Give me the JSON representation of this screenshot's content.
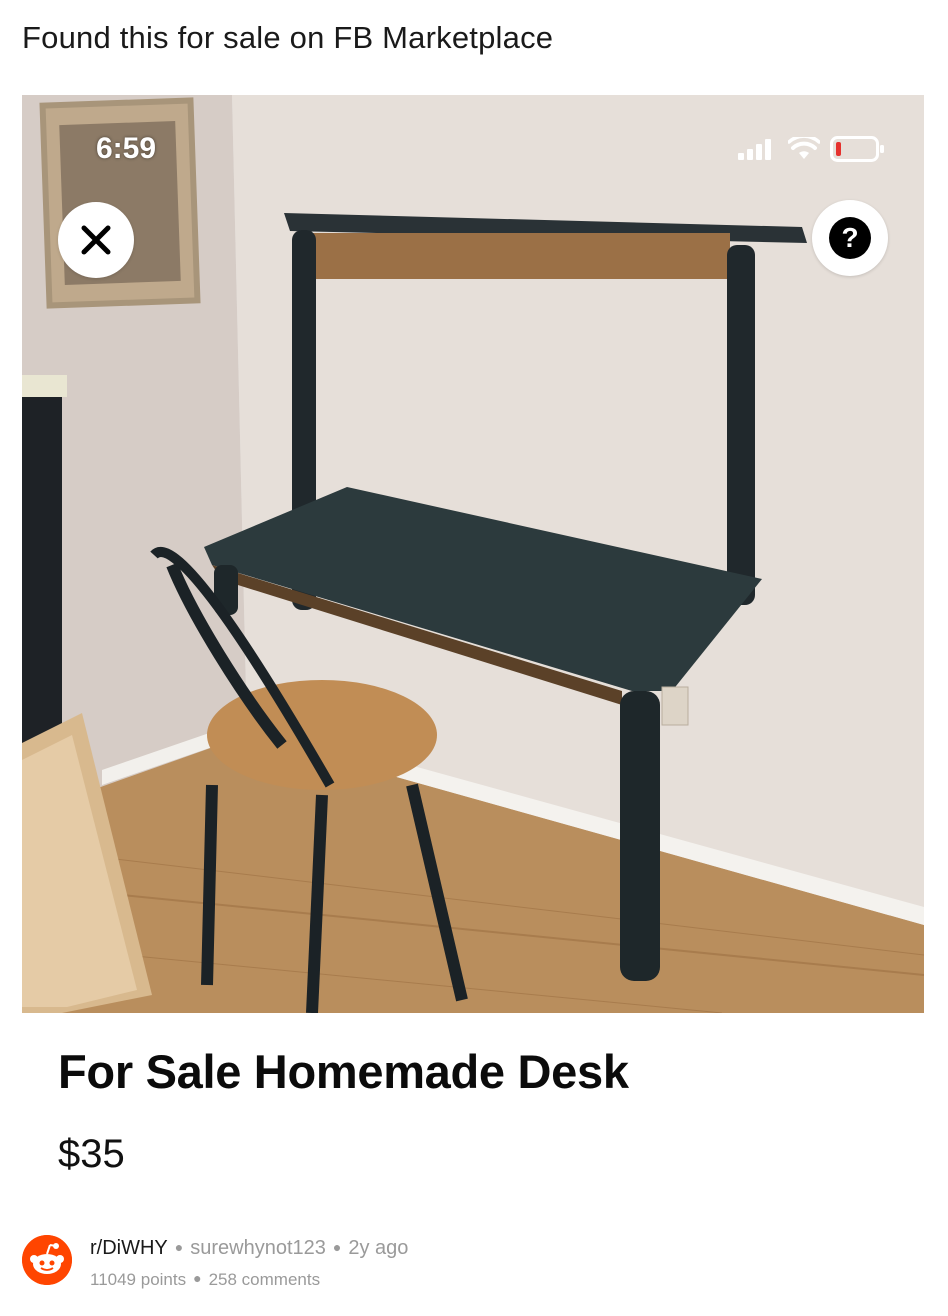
{
  "post": {
    "title": "Found this for sale on FB Marketplace",
    "subreddit": "r/DiWHY",
    "author": "surewhynot123",
    "age": "2y ago",
    "points": "11049 points",
    "comments": "258 comments"
  },
  "screenshot": {
    "status_time": "6:59",
    "status_icons": [
      "signal-bars-icon",
      "wifi-icon",
      "battery-low-icon"
    ],
    "close_icon": "close-icon",
    "help_label": "?",
    "listing_title": "For Sale Homemade Desk",
    "listing_price": "$35"
  },
  "colors": {
    "reddit_orange": "#ff4500",
    "battery_low": "#e5312d"
  }
}
